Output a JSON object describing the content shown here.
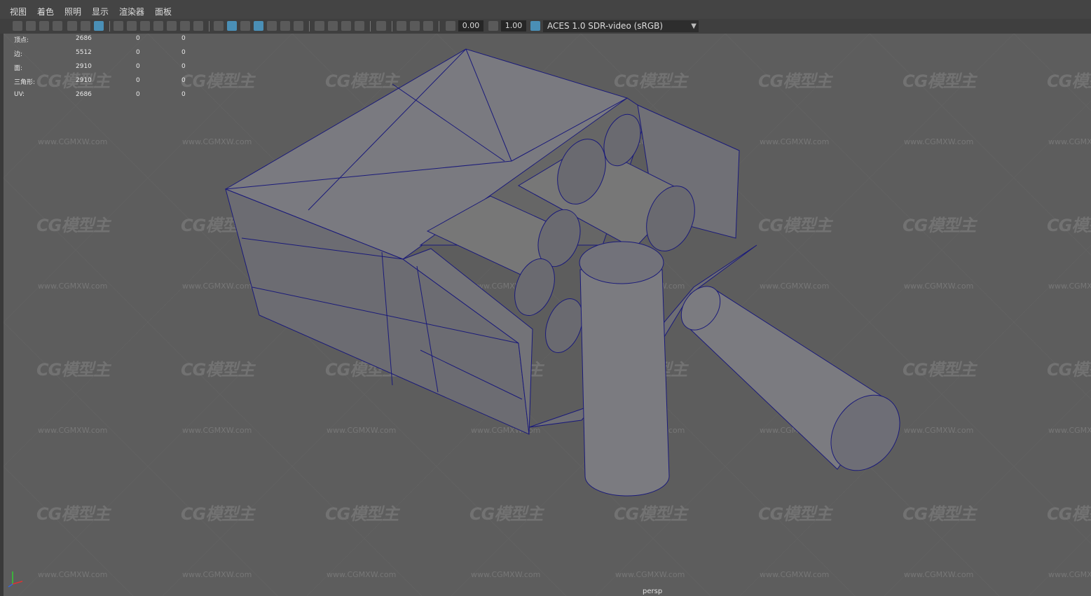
{
  "menu": [
    "视图",
    "着色",
    "照明",
    "显示",
    "渲染器",
    "面板"
  ],
  "toolbar": {
    "exposure_value": "0.00",
    "gamma_value": "1.00",
    "color_space": "ACES 1.0 SDR-video (sRGB)",
    "icons": [
      "camera-icon",
      "camera-attributes-icon",
      "bookmark-icon",
      "image-plane-icon",
      "grid-icon",
      "film-gate-icon",
      "resolution-gate-icon",
      "gate-mask-icon",
      "field-chart-icon",
      "safe-action-icon",
      "safe-title-icon",
      "wireframe-icon",
      "smooth-shade-icon",
      "textured-icon",
      "wireframe-on-shaded-icon",
      "xray-icon",
      "lights-icon",
      "shadows-icon",
      "ambient-occlusion-icon",
      "motion-blur-icon",
      "isolate-select-icon",
      "xray-joints-icon",
      "exposure-icon",
      "gamma-icon",
      "color-management-icon"
    ]
  },
  "stats": [
    {
      "label": "顶点:",
      "values": [
        "2686",
        "0",
        "0"
      ]
    },
    {
      "label": "边:",
      "values": [
        "5512",
        "0",
        "0"
      ]
    },
    {
      "label": "面:",
      "values": [
        "2910",
        "0",
        "0"
      ]
    },
    {
      "label": "三角形:",
      "values": [
        "2910",
        "0",
        "0"
      ]
    },
    {
      "label": "UV:",
      "values": [
        "2686",
        "0",
        "0"
      ]
    }
  ],
  "watermark": {
    "logo": "CG模型主",
    "url": "www.CGMXW.com"
  },
  "camera": "persp",
  "colors": {
    "wire": "#1a1a7a",
    "mesh": "#7c7c80",
    "mesh_dark": "#6a6a70"
  }
}
